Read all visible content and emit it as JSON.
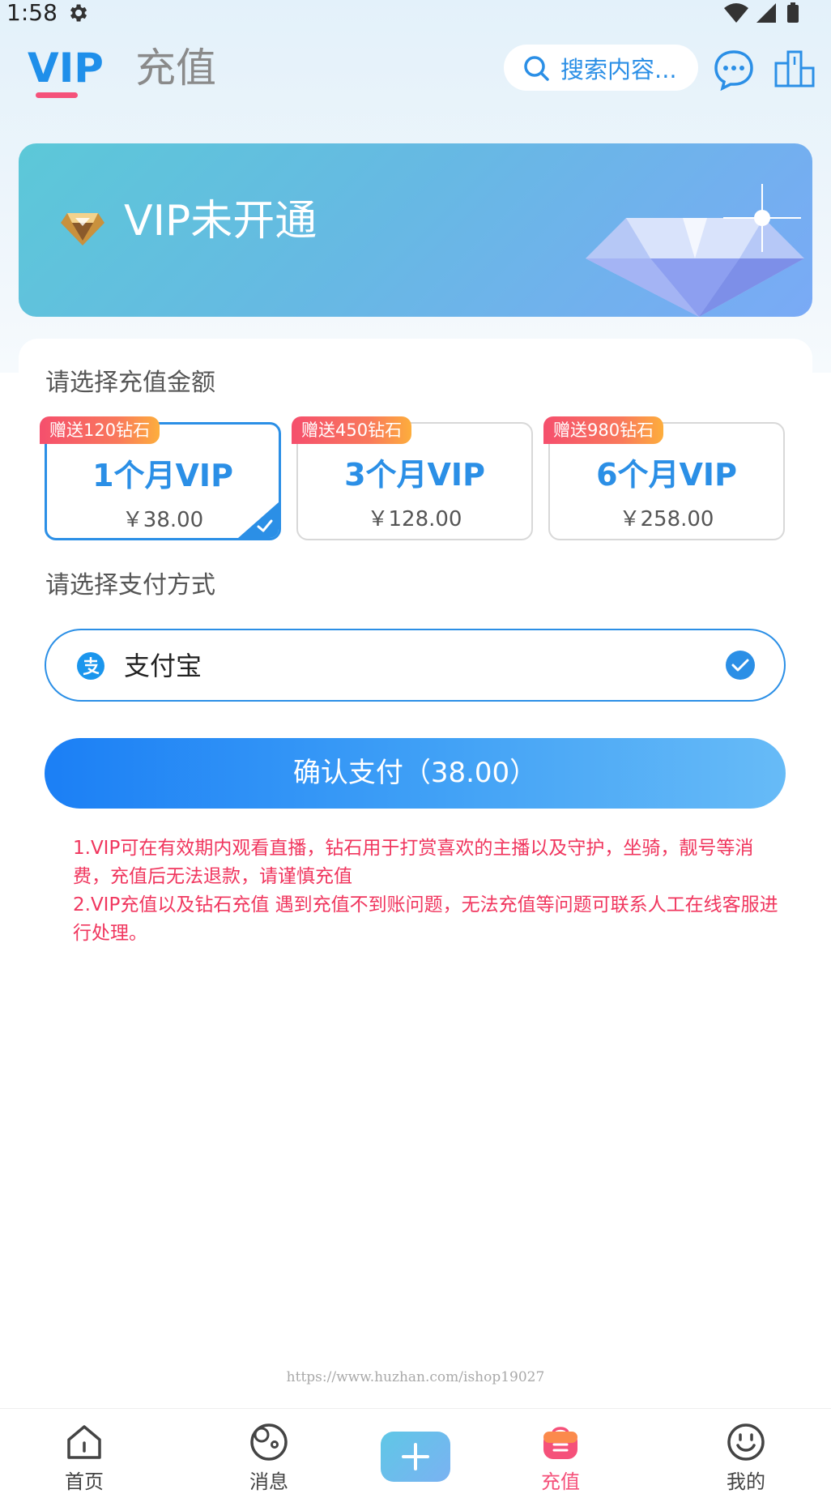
{
  "status_bar": {
    "time": "1:58",
    "icons": [
      "gear-icon",
      "wifi-icon",
      "signal-icon",
      "battery-icon"
    ]
  },
  "header": {
    "tabs": [
      {
        "label": "VIP",
        "active": true
      },
      {
        "label": "充值",
        "active": false
      }
    ],
    "search": {
      "placeholder": "搜索内容..."
    },
    "icons": [
      "search-icon",
      "chat-icon",
      "ranking-icon"
    ]
  },
  "banner": {
    "title": "VIP未开通",
    "icons": [
      "gem-icon",
      "diamond-illustration"
    ]
  },
  "amount_section": {
    "label": "请选择充值金额",
    "plans": [
      {
        "badge": "赠送120钻石",
        "name": "1个月VIP",
        "price": "￥38.00",
        "selected": true
      },
      {
        "badge": "赠送450钻石",
        "name": "3个月VIP",
        "price": "￥128.00",
        "selected": false
      },
      {
        "badge": "赠送980钻石",
        "name": "6个月VIP",
        "price": "￥258.00",
        "selected": false
      }
    ]
  },
  "payment_section": {
    "label": "请选择支付方式",
    "method": {
      "label": "支付宝",
      "icon": "alipay-icon",
      "selected": true
    }
  },
  "confirm_button": {
    "label": "确认支付（38.00）"
  },
  "notes": [
    "1.VIP可在有效期内观看直播，钻石用于打赏喜欢的主播以及守护，坐骑，靓号等消费，充值后无法退款，请谨慎充值",
    "2.VIP充值以及钻石充值 遇到充值不到账问题，无法充值等问题可联系人工在线客服进行处理。"
  ],
  "watermark": "https://www.huzhan.com/ishop19027",
  "bottom_nav": {
    "items": [
      {
        "label": "首页",
        "icon": "home-icon",
        "active": false
      },
      {
        "label": "消息",
        "icon": "message-icon",
        "active": false
      },
      {
        "label": "",
        "icon": "plus-icon",
        "active": false
      },
      {
        "label": "充值",
        "icon": "shopping-bag-icon",
        "active": true
      },
      {
        "label": "我的",
        "icon": "smiley-icon",
        "active": false
      }
    ]
  },
  "colors": {
    "accent": "#2b8fe6",
    "tab_underline": "#f5517a",
    "notes_text": "#f0365e",
    "nav_active": "#f5517a"
  }
}
